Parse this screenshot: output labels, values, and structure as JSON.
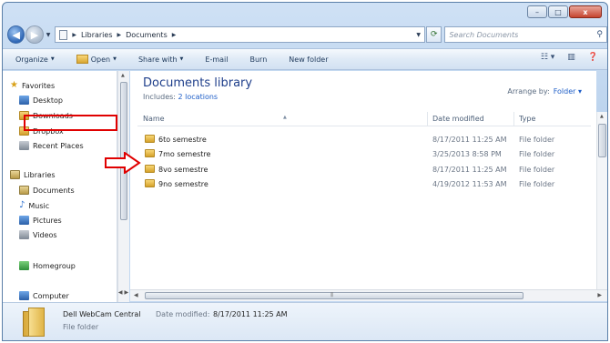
{
  "window": {
    "minimize": "–",
    "maximize": "□",
    "close": "x"
  },
  "address": {
    "back": "◀",
    "forward": "▶",
    "path": [
      "Libraries",
      "Documents"
    ],
    "search_placeholder": "Search Documents"
  },
  "toolbar": {
    "organize": "Organize",
    "open": "Open",
    "share_with": "Share with",
    "email": "E-mail",
    "burn": "Burn",
    "new_folder": "New folder"
  },
  "nav": {
    "favorites": "Favorites",
    "desktop": "Desktop",
    "downloads": "Downloads",
    "dropbox": "Dropbox",
    "recent": "Recent Places",
    "libraries": "Libraries",
    "documents": "Documents",
    "music": "Music",
    "pictures": "Pictures",
    "videos": "Videos",
    "homegroup": "Homegroup",
    "computer": "Computer"
  },
  "library": {
    "title": "Documents library",
    "includes_label": "Includes:",
    "includes_link": "2 locations",
    "arrange_label": "Arrange by:",
    "arrange_value": "Folder ▾"
  },
  "columns": {
    "name": "Name",
    "date": "Date modified",
    "type": "Type"
  },
  "files": [
    {
      "name": "6to semestre",
      "date": "8/17/2011 11:25 AM",
      "type": "File folder"
    },
    {
      "name": "7mo semestre",
      "date": "3/25/2013 8:58 PM",
      "type": "File folder"
    },
    {
      "name": "8vo semestre",
      "date": "8/17/2011 11:25 AM",
      "type": "File folder"
    },
    {
      "name": "9no semestre",
      "date": "4/19/2012 11:53 AM",
      "type": "File folder"
    }
  ],
  "details": {
    "name": "Dell WebCam Central",
    "modified_label": "Date modified:",
    "modified_value": "8/17/2011 11:25 AM",
    "type": "File folder"
  },
  "colors": {
    "highlight": "#e00000",
    "library_title": "#1e3e8a",
    "link": "#1e5ec8"
  }
}
